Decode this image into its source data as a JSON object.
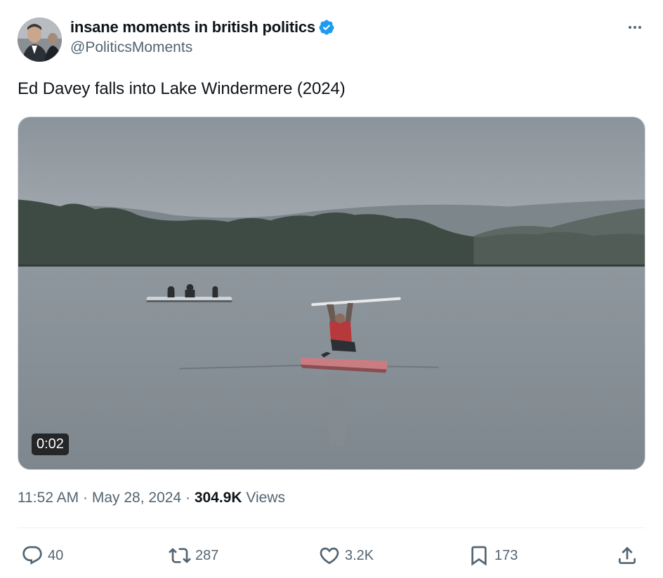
{
  "author": {
    "name": "insane moments in british politics",
    "handle": "@PoliticsMoments",
    "verified": true,
    "verified_color": "#1d9bf0"
  },
  "tweet": {
    "text": "Ed Davey falls into Lake Windermere (2024)"
  },
  "media": {
    "type": "video",
    "duration": "0:02"
  },
  "meta": {
    "time": "11:52 AM",
    "separator": "·",
    "date": "May 28, 2024",
    "views_count": "304.9K",
    "views_label": "Views"
  },
  "actions": {
    "replies": "40",
    "reposts": "287",
    "likes": "3.2K",
    "bookmarks": "173"
  },
  "icons": [
    "more-icon",
    "verified-icon",
    "reply-icon",
    "repost-icon",
    "like-icon",
    "bookmark-icon",
    "share-icon"
  ]
}
